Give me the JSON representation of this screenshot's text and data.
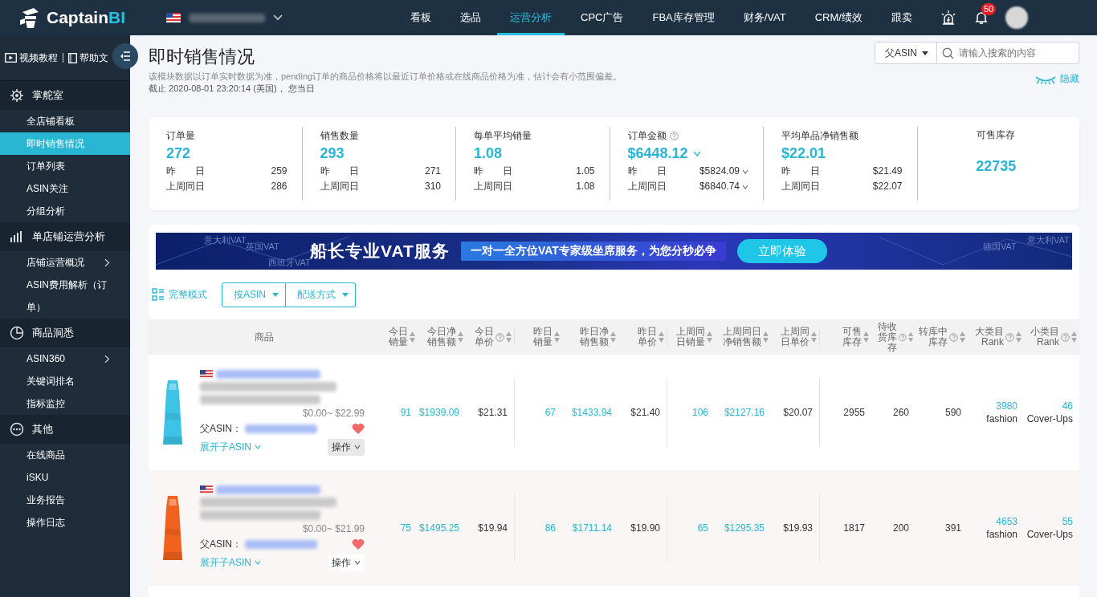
{
  "brand": {
    "name": "Captain",
    "accent": "BI"
  },
  "nav": [
    {
      "label": "看板",
      "selected": false
    },
    {
      "label": "选品",
      "selected": false
    },
    {
      "label": "运营分析",
      "selected": true
    },
    {
      "label": "CPC广告",
      "selected": false
    },
    {
      "label": "FBA库存管理",
      "selected": false
    },
    {
      "label": "财务/VAT",
      "selected": false
    },
    {
      "label": "CRM/绩效",
      "selected": false
    },
    {
      "label": "跟卖",
      "selected": false
    }
  ],
  "notifications": {
    "count": "50"
  },
  "sidebar": {
    "links": [
      "视频教程",
      "帮助文"
    ],
    "sections": [
      {
        "label": "掌舵室",
        "kind": "gear",
        "children": [
          {
            "label": "全店铺看板",
            "selected": false,
            "expandable": false
          },
          {
            "label": "即时销售情况",
            "selected": true,
            "expandable": false
          },
          {
            "label": "订单列表",
            "selected": false,
            "expandable": false
          },
          {
            "label": "ASIN关注",
            "selected": false,
            "expandable": false
          },
          {
            "label": "分组分析",
            "selected": false,
            "expandable": false
          }
        ]
      },
      {
        "label": "单店铺运营分析",
        "kind": "bars",
        "children": [
          {
            "label": "店铺运营概况",
            "selected": false,
            "expandable": true
          },
          {
            "label": "ASIN费用解析（订单）",
            "selected": false,
            "expandable": false
          }
        ]
      },
      {
        "label": "商品洞悉",
        "kind": "pie",
        "children": [
          {
            "label": "ASIN360",
            "selected": false,
            "expandable": true
          },
          {
            "label": "关键词排名",
            "selected": false,
            "expandable": false
          },
          {
            "label": "指标监控",
            "selected": false,
            "expandable": false
          }
        ]
      },
      {
        "label": "其他",
        "kind": "dots",
        "children": [
          {
            "label": "在线商品",
            "selected": false,
            "expandable": false
          },
          {
            "label": "iSKU",
            "selected": false,
            "expandable": false
          },
          {
            "label": "业务报告",
            "selected": false,
            "expandable": false
          },
          {
            "label": "操作日志",
            "selected": false,
            "expandable": false
          }
        ]
      }
    ]
  },
  "header": {
    "title": "即时销售情况",
    "description": "该模块数据以订单实时数据为准，pending订单的商品价格将以最近订单价格或在线商品价格为准，估计会有小范围偏差。",
    "timestamp": "截止 2020-08-01 23:20:14 (美国)， 您当日",
    "filter": "父ASIN",
    "search_placeholder": "请输入搜索的内容",
    "hide_link": "隐藏"
  },
  "stats": [
    {
      "kind": "compare",
      "label": "订单量",
      "help": false,
      "value": "272",
      "dropdown": false,
      "rows": [
        {
          "label": "昨　　日",
          "value": "259",
          "dropdown": false
        },
        {
          "label": "上周同日",
          "value": "286",
          "dropdown": false
        }
      ]
    },
    {
      "kind": "compare",
      "label": "销售数量",
      "help": false,
      "value": "293",
      "dropdown": false,
      "rows": [
        {
          "label": "昨　　日",
          "value": "271",
          "dropdown": false
        },
        {
          "label": "上周同日",
          "value": "310",
          "dropdown": false
        }
      ]
    },
    {
      "kind": "compare",
      "label": "每单平均销量",
      "help": false,
      "value": "1.08",
      "dropdown": false,
      "rows": [
        {
          "label": "昨　　日",
          "value": "1.05",
          "dropdown": false
        },
        {
          "label": "上周同日",
          "value": "1.08",
          "dropdown": false
        }
      ]
    },
    {
      "kind": "compare",
      "label": "订单金额",
      "help": true,
      "value": "$6448.12",
      "dropdown": true,
      "rows": [
        {
          "label": "昨　　日",
          "value": "$5824.09",
          "dropdown": true
        },
        {
          "label": "上周同日",
          "value": "$6840.74",
          "dropdown": true
        }
      ]
    },
    {
      "kind": "compare",
      "label": "平均单品净销售额",
      "help": false,
      "value": "$22.01",
      "dropdown": false,
      "rows": [
        {
          "label": "昨　　日",
          "value": "$21.49",
          "dropdown": false
        },
        {
          "label": "上周同日",
          "value": "$22.07",
          "dropdown": false
        }
      ]
    },
    {
      "kind": "single",
      "label": "可售库存",
      "value": "22735"
    }
  ],
  "banner": {
    "title": "船长专业VAT服务",
    "subtitle": "一对一全方位VAT专家级坐席服务，为您分秒必争",
    "button": "立即体验",
    "tags": [
      "意大利VAT",
      "英国VAT",
      "西班牙VAT",
      "德国VAT",
      "意大利VAT"
    ]
  },
  "toolbar": {
    "mode": "完整模式",
    "dropdowns": [
      "按ASIN",
      "配送方式"
    ]
  },
  "table": {
    "columns": [
      {
        "label": "商品",
        "kind": "product"
      },
      {
        "label": "今日销量",
        "kind": "number",
        "sortable": true,
        "help": false,
        "link": true,
        "group_start": false
      },
      {
        "label": "今日净销售额",
        "kind": "number",
        "sortable": true,
        "help": false,
        "link": true,
        "group_start": false
      },
      {
        "label": "今日单价",
        "kind": "number",
        "sortable": true,
        "help": true,
        "link": false,
        "group_start": false
      },
      {
        "label": "昨日销量",
        "kind": "number",
        "sortable": true,
        "help": false,
        "link": true,
        "group_start": true
      },
      {
        "label": "昨日净销售额",
        "kind": "number",
        "sortable": true,
        "help": false,
        "link": true,
        "group_start": false
      },
      {
        "label": "昨日单价",
        "kind": "number",
        "sortable": true,
        "help": false,
        "link": false,
        "group_start": false
      },
      {
        "label": "上周同日销量",
        "kind": "number",
        "sortable": true,
        "help": false,
        "link": true,
        "group_start": true
      },
      {
        "label": "上周同日净销售额",
        "kind": "number",
        "sortable": true,
        "help": false,
        "link": true,
        "group_start": false
      },
      {
        "label": "上周同日单价",
        "kind": "number",
        "sortable": true,
        "help": false,
        "link": false,
        "group_start": false
      },
      {
        "label": "可售库存",
        "kind": "number",
        "sortable": true,
        "help": false,
        "link": false,
        "group_start": true
      },
      {
        "label": "待收货库存",
        "kind": "number",
        "sortable": true,
        "help": true,
        "link": false,
        "group_start": false
      },
      {
        "label": "转库中库存",
        "kind": "number",
        "sortable": true,
        "help": true,
        "link": false,
        "group_start": false
      },
      {
        "label": "大类目Rank",
        "kind": "rank",
        "sortable": true,
        "help": true,
        "link": true,
        "group_start": false
      },
      {
        "label": "小类目Rank",
        "kind": "rank",
        "sortable": true,
        "help": true,
        "link": true,
        "group_start": false
      }
    ],
    "rows": [
      {
        "highlighted": false,
        "cells": [
          {
            "price": "$0.00~ $22.99",
            "parent_label": "父ASIN：",
            "favorite": true,
            "expand": "展开子ASIN",
            "action": "操作"
          },
          "91",
          "$1939.09",
          "$21.31",
          "67",
          "$1433.94",
          "$21.40",
          "106",
          "$2127.16",
          "$20.07",
          "2955",
          "260",
          "590",
          {
            "rank": "3980",
            "category": "fashion"
          },
          {
            "rank": "46",
            "category": "Cover-Ups"
          }
        ]
      },
      {
        "highlighted": true,
        "cells": [
          {
            "price": "$0.00~ $21.99",
            "parent_label": "父ASIN：",
            "favorite": true,
            "expand": "展开子ASIN",
            "action": "操作"
          },
          "75",
          "$1495.25",
          "$19.94",
          "86",
          "$1711.14",
          "$19.90",
          "65",
          "$1295.35",
          "$19.93",
          "1817",
          "200",
          "391",
          {
            "rank": "4653",
            "category": "fashion"
          },
          {
            "rank": "55",
            "category": "Cover-Ups"
          }
        ]
      }
    ]
  }
}
